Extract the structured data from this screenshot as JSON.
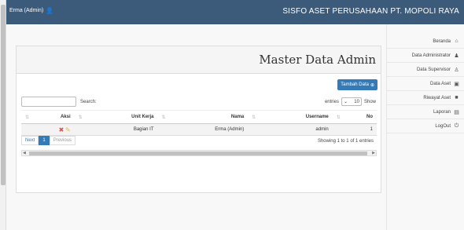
{
  "header": {
    "brand": "SISFO ASET PERUSAHAAN PT. MOPOLI RAYA",
    "user_name": "Erma (Admin)"
  },
  "sidebar": {
    "items": [
      {
        "label": "Beranda",
        "icon": "home-icon"
      },
      {
        "label": "Data Administrator",
        "icon": "user-icon"
      },
      {
        "label": "Data Supervisor",
        "icon": "users-icon"
      },
      {
        "label": "Data Aset",
        "icon": "database-icon"
      },
      {
        "label": "Riwayat Aset",
        "icon": "history-icon"
      },
      {
        "label": "Laporan",
        "icon": "report-icon"
      },
      {
        "label": "LogOut",
        "icon": "power-icon"
      }
    ]
  },
  "main": {
    "title": "Master Data Admin",
    "add_button": "Tambah Data",
    "show_label": "Show",
    "entries_value": "10",
    "entries_label": "entries",
    "search_label": "Search:",
    "table": {
      "columns": [
        "No",
        "Username",
        "Nama",
        "Unit Kerja",
        "Aksi"
      ],
      "rows": [
        {
          "no": "1",
          "username": "admin",
          "nama": "Erma (Admin)",
          "unit": "Bagian IT"
        }
      ]
    },
    "info": "Showing 1 to 1 of 1 entries",
    "pager": {
      "previous": "Previous",
      "page": "1",
      "next": "Next"
    }
  },
  "colors": {
    "topbar": "#3c5a7a",
    "primary": "#337ab7",
    "danger": "#d9534f",
    "edit": "#f0ad4e"
  }
}
